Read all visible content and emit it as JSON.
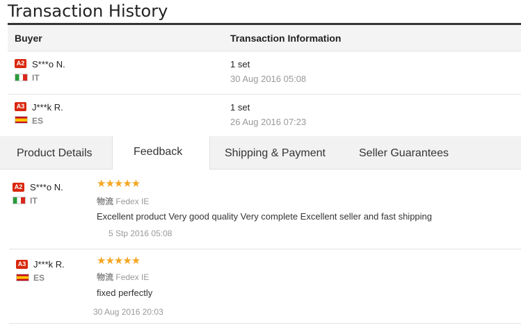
{
  "page_title": "Transaction History",
  "history": {
    "headers": {
      "buyer": "Buyer",
      "info": "Transaction Information"
    },
    "rows": [
      {
        "level": "A2",
        "buyer": "S***o N.",
        "country": "IT",
        "quantity": "1 set",
        "date": "30 Aug 2016 05:08"
      },
      {
        "level": "A3",
        "buyer": "J***k R.",
        "country": "ES",
        "quantity": "1 set",
        "date": "26 Aug 2016 07:23"
      }
    ]
  },
  "tabs": {
    "product_details": "Product Details",
    "feedback": "Feedback",
    "shipping_payment": "Shipping & Payment",
    "seller_guarantees": "Seller Guarantees",
    "active": "Feedback"
  },
  "feedback": [
    {
      "level": "A2",
      "buyer": "S***o N.",
      "country": "IT",
      "stars": "★★★★★",
      "rating": 5,
      "carrier_label": "物流",
      "carrier": "Fedex IE",
      "text": "Excellent product Very good quality Very complete Excellent seller and fast shipping",
      "date_prefix": "5 Stp",
      "date": "2016 05:08"
    },
    {
      "level": "A3",
      "buyer": "J***k R.",
      "country": "ES",
      "stars": "★★★★★",
      "rating": 5,
      "carrier_label": "物流",
      "carrier": "Fedex IE",
      "text": "fixed perfectly",
      "date_prefix": "30 Aug",
      "date": "2016 20:03"
    }
  ],
  "colors": {
    "level_badge": "#d9280f",
    "stars": "#f5a623",
    "header_border": "#333333"
  }
}
